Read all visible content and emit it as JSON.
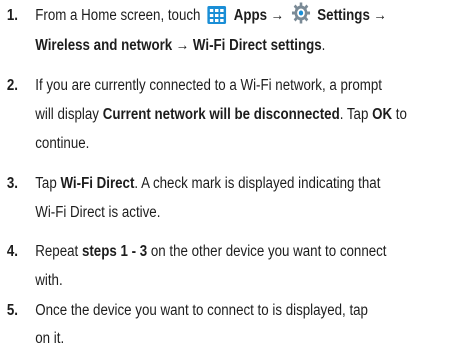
{
  "steps": [
    {
      "number": "1.",
      "lines": [
        [
          "From a Home screen, touch",
          "Apps →",
          "Settings →"
        ],
        [
          "Wireless and network → Wi-Fi Direct settings",
          "."
        ]
      ],
      "icons": [
        "apps-grid-icon",
        "settings-gear-icon"
      ]
    },
    {
      "number": "2.",
      "lines": [
        [
          "If you are currently connected to a Wi-Fi network, a prompt"
        ],
        [
          "will display",
          "Current network will be disconnected",
          ". Tap",
          "OK",
          "to"
        ],
        [
          "continue."
        ]
      ]
    },
    {
      "number": "3.",
      "lines": [
        [
          "Tap",
          "Wi-Fi Direct",
          ". A check mark is displayed indicating that"
        ],
        [
          "Wi-Fi Direct is active."
        ]
      ]
    },
    {
      "number": "4.",
      "lines": [
        [
          "Repeat",
          "steps 1 - 3",
          "on the other device you want to connect"
        ],
        [
          "with."
        ]
      ]
    },
    {
      "number": "5.",
      "lines": [
        [
          "Once the device you want to connect to is displayed, tap"
        ],
        [
          "on it."
        ]
      ]
    }
  ],
  "colors": {
    "text": "#1d1d1d",
    "apps_icon": "#1a8ed6",
    "gear_icon": "#7a8a96"
  }
}
